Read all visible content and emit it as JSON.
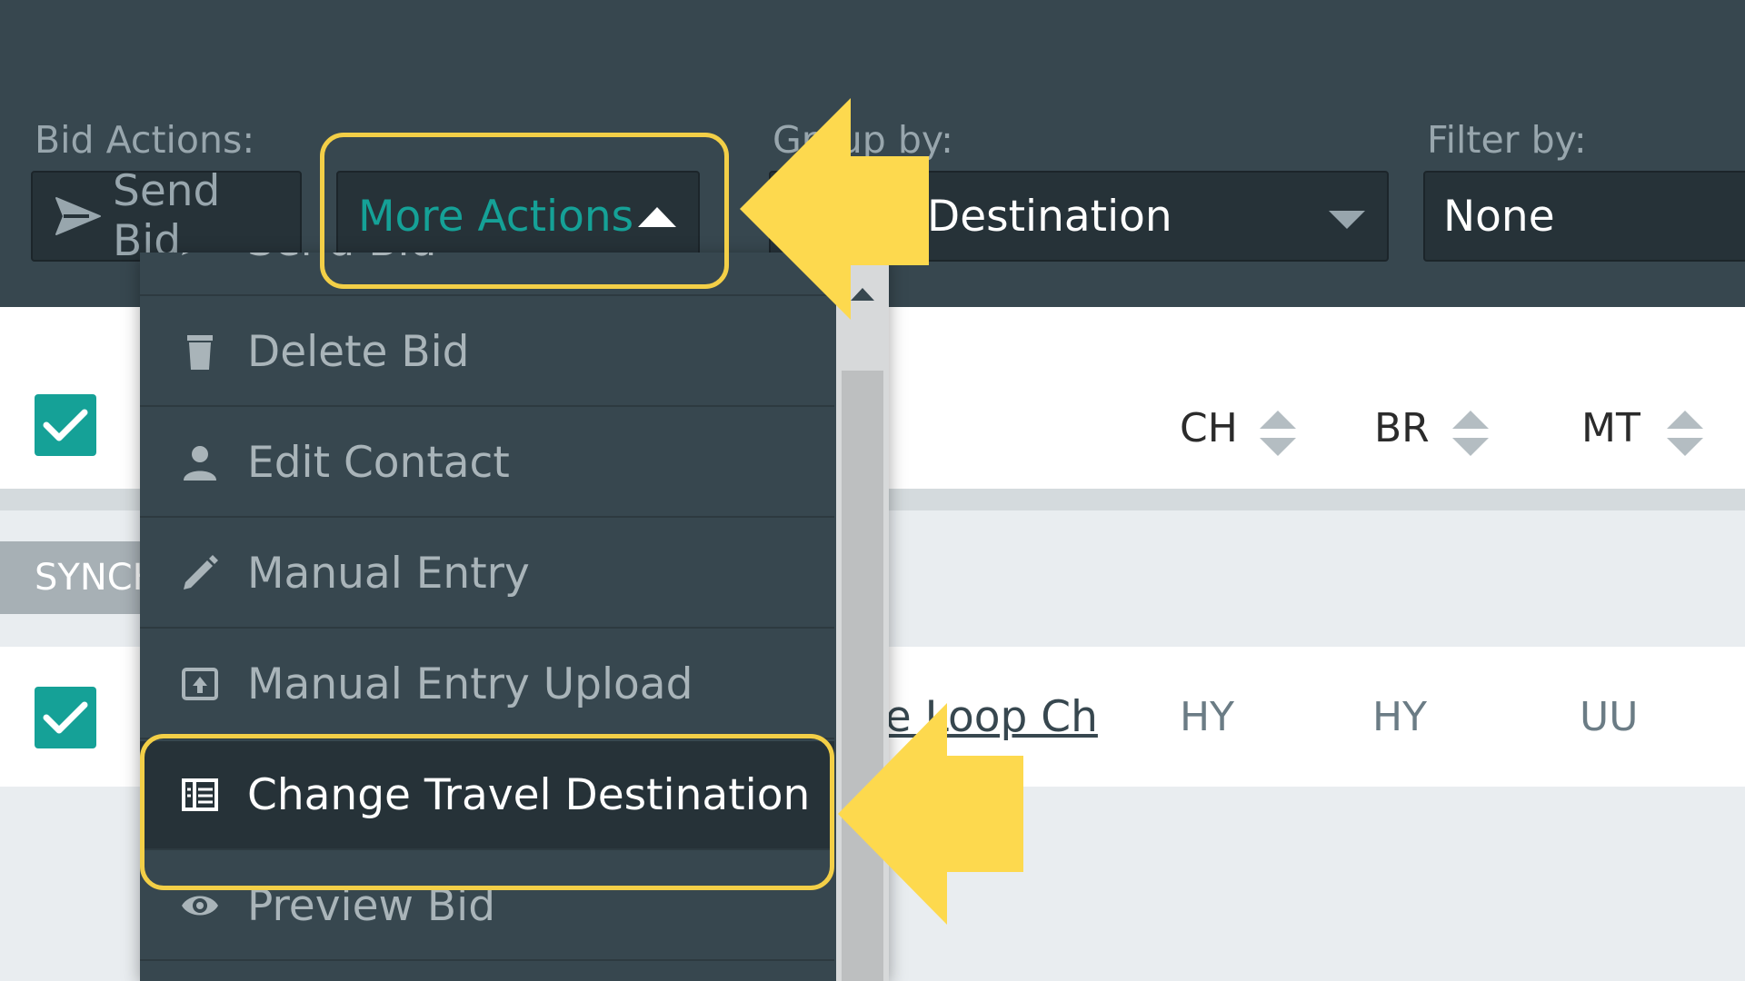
{
  "toolbar": {
    "bid_actions_label": "Bid Actions:",
    "send_bid_label": "Send Bid",
    "more_actions_label": "More Actions",
    "group_by_label": "Group by:",
    "group_by_value": "Destination",
    "filter_by_label": "Filter by:",
    "filter_by_value": "None"
  },
  "menu": {
    "items": [
      {
        "label": "Send Bid",
        "icon": "send-icon"
      },
      {
        "label": "Delete Bid",
        "icon": "trash-icon"
      },
      {
        "label": "Edit Contact",
        "icon": "person-icon"
      },
      {
        "label": "Manual Entry",
        "icon": "pencil-icon"
      },
      {
        "label": "Manual Entry Upload",
        "icon": "upload-icon"
      },
      {
        "label": "Change Travel Destination",
        "icon": "directory-icon",
        "active": true
      },
      {
        "label": "Preview Bid",
        "icon": "eye-icon"
      }
    ]
  },
  "table": {
    "columns": [
      "CH",
      "BR",
      "MT"
    ],
    "section_label": "SYNCH",
    "row": {
      "link_text": "he Loop Ch",
      "values": [
        "HY",
        "HY",
        "UU"
      ]
    }
  },
  "colors": {
    "topbar": "#37474f",
    "accent_teal": "#15a197",
    "highlight_yellow": "#f3cf47",
    "arrow_yellow": "#fdd94e"
  }
}
